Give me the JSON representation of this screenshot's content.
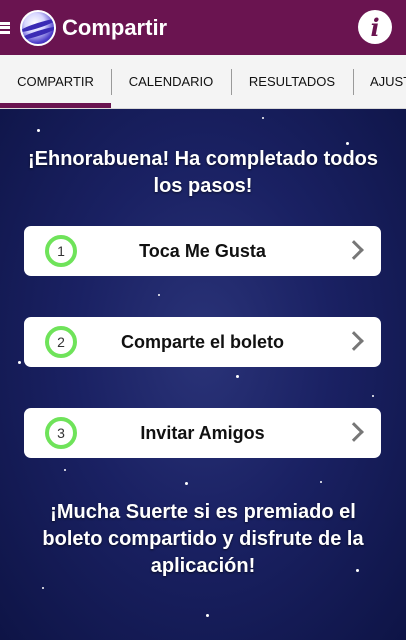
{
  "appbar": {
    "title": "Compartir",
    "info_label": "i"
  },
  "tabs": [
    {
      "label": "COMPARTIR",
      "active": true
    },
    {
      "label": "CALENDARIO",
      "active": false
    },
    {
      "label": "RESULTADOS",
      "active": false
    },
    {
      "label": "AJUSTES",
      "active": false
    }
  ],
  "main": {
    "headline": "¡Ehnorabuena! Ha completado todos los pasos!",
    "steps": [
      {
        "number": "1",
        "label": "Toca Me Gusta"
      },
      {
        "number": "2",
        "label": "Comparte el boleto"
      },
      {
        "number": "3",
        "label": "Invitar Amigos"
      }
    ],
    "footer": "¡Mucha Suerte si es premiado el boleto compartido y disfrute de la aplicación!"
  },
  "colors": {
    "brand": "#6a1450",
    "step_ring": "#6fe35a",
    "background": "#1a2163"
  }
}
